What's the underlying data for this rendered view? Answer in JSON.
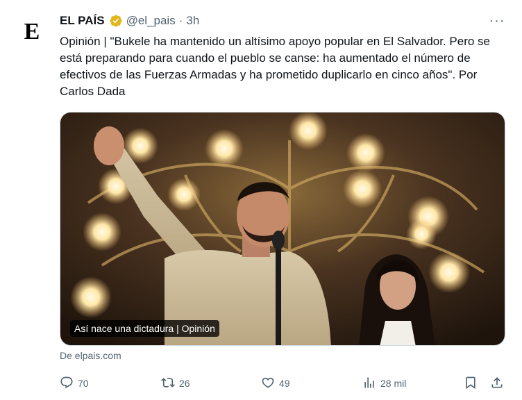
{
  "author": {
    "avatar_letter": "E",
    "name": "EL PAÍS",
    "handle": "@el_pais",
    "separator": "·",
    "time": "3h"
  },
  "more_label": "···",
  "text": "Opinión | \"Bukele ha mantenido un altísimo apoyo popular en El Salvador. Pero se está preparando para cuando el pueblo se canse: ha aumentado el número de efectivos de las Fuerzas Armadas y ha prometido duplicarlo en cinco años\". Por Carlos Dada",
  "media": {
    "caption": "Así nace una dictadura | Opinión"
  },
  "source": "De elpais.com",
  "actions": {
    "reply_count": "70",
    "repost_count": "26",
    "like_count": "49",
    "views_count": "28 mil"
  },
  "icons": {
    "verified": "verified-badge-icon",
    "reply": "reply-icon",
    "repost": "repost-icon",
    "like": "like-icon",
    "views": "views-icon",
    "bookmark": "bookmark-icon",
    "share": "share-icon"
  },
  "colors": {
    "text": "#0f1419",
    "secondary": "#536471",
    "verified_gold": "#e2b719"
  }
}
